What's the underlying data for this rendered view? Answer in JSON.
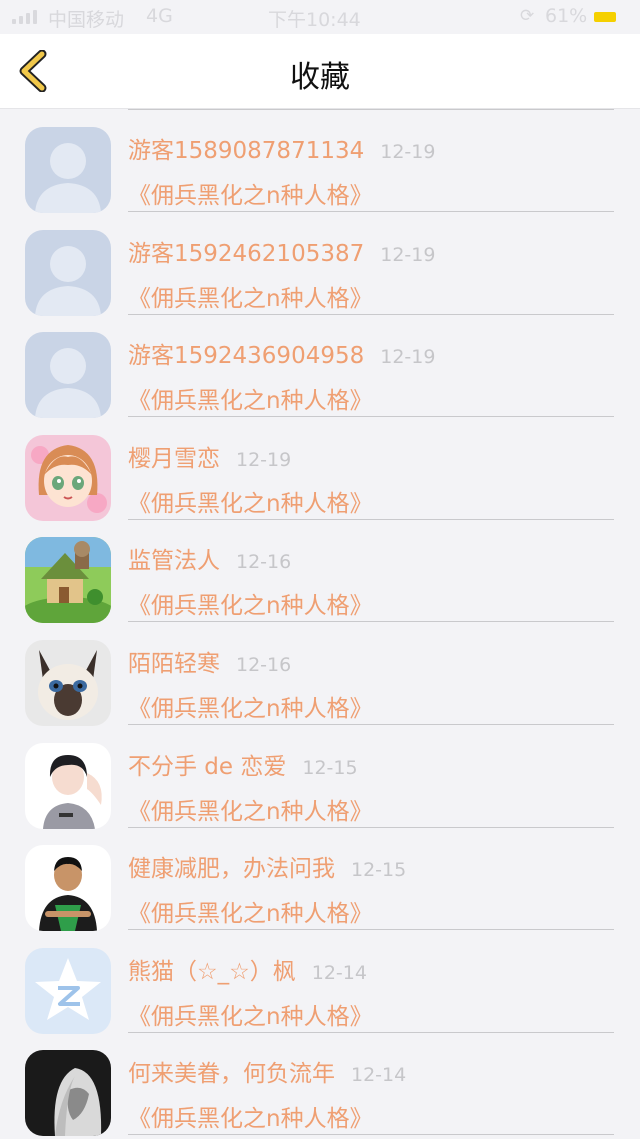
{
  "status_bar": {
    "carrier": "中国移动",
    "network": "4G",
    "time": "下午10:44",
    "battery": "61%",
    "battery_color": "#f5d000"
  },
  "nav": {
    "title": "收藏",
    "back_icon": "chevron-left-icon",
    "accent": "#f1c84a"
  },
  "items": [
    {
      "name": "游客1589087871134",
      "date": "12-19",
      "book": "《佣兵黑化之n种人格》",
      "avatar": "default-avatar-icon"
    },
    {
      "name": "游客1592462105387",
      "date": "12-19",
      "book": "《佣兵黑化之n种人格》",
      "avatar": "default-avatar-icon"
    },
    {
      "name": "游客1592436904958",
      "date": "12-19",
      "book": "《佣兵黑化之n种人格》",
      "avatar": "default-avatar-icon"
    },
    {
      "name": "樱月雪恋",
      "date": "12-19",
      "book": "《佣兵黑化之n种人格》",
      "avatar": "anime-girl-avatar"
    },
    {
      "name": "监管法人",
      "date": "12-16",
      "book": "《佣兵黑化之n种人格》",
      "avatar": "cottage-avatar"
    },
    {
      "name": "陌陌轻寒",
      "date": "12-16",
      "book": "《佣兵黑化之n种人格》",
      "avatar": "siamese-cat-avatar"
    },
    {
      "name": "不分手 de 恋爱",
      "date": "12-15",
      "book": "《佣兵黑化之n种人格》",
      "avatar": "girl-photo-avatar"
    },
    {
      "name": "健康减肥，办法问我",
      "date": "12-15",
      "book": "《佣兵黑化之n种人格》",
      "avatar": "man-photo-avatar"
    },
    {
      "name": "熊猫（☆_☆）枫",
      "date": "12-14",
      "book": "《佣兵黑化之n种人格》",
      "avatar": "qzone-star-avatar"
    },
    {
      "name": "何来美眷，何负流年",
      "date": "12-14",
      "book": "《佣兵黑化之n种人格》",
      "avatar": "bw-portrait-avatar"
    }
  ],
  "colors": {
    "name": "#ef9f72",
    "date": "#c6c6c9",
    "background": "#f3f3f6"
  }
}
